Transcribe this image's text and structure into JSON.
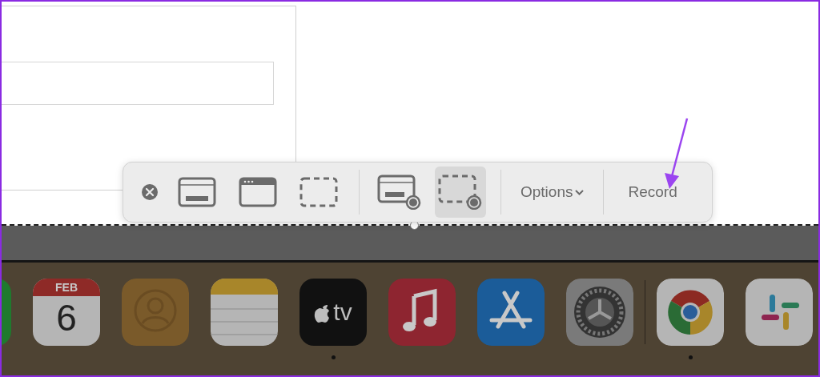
{
  "toolbar": {
    "buttons": [
      {
        "kind": "close",
        "selected": false
      },
      {
        "kind": "capture-screen",
        "selected": false
      },
      {
        "kind": "capture-window",
        "selected": false
      },
      {
        "kind": "capture-selection",
        "selected": false
      },
      {
        "kind": "divider"
      },
      {
        "kind": "record-screen",
        "selected": false
      },
      {
        "kind": "record-selection",
        "selected": true
      },
      {
        "kind": "divider"
      },
      {
        "kind": "options",
        "label": "Options"
      },
      {
        "kind": "divider"
      },
      {
        "kind": "record",
        "label": "Record"
      }
    ]
  },
  "dock": {
    "items": [
      {
        "kind": "green-app",
        "running": false
      },
      {
        "kind": "calendar",
        "month": "FEB",
        "day": "6",
        "running": false
      },
      {
        "kind": "contacts",
        "running": false
      },
      {
        "kind": "notes",
        "running": false
      },
      {
        "kind": "tv",
        "label": "tv",
        "running": true
      },
      {
        "kind": "music",
        "running": false
      },
      {
        "kind": "app-store",
        "running": false
      },
      {
        "kind": "settings",
        "running": false
      },
      {
        "kind": "separator"
      },
      {
        "kind": "chrome",
        "running": true
      },
      {
        "kind": "slack",
        "running": false
      }
    ]
  }
}
